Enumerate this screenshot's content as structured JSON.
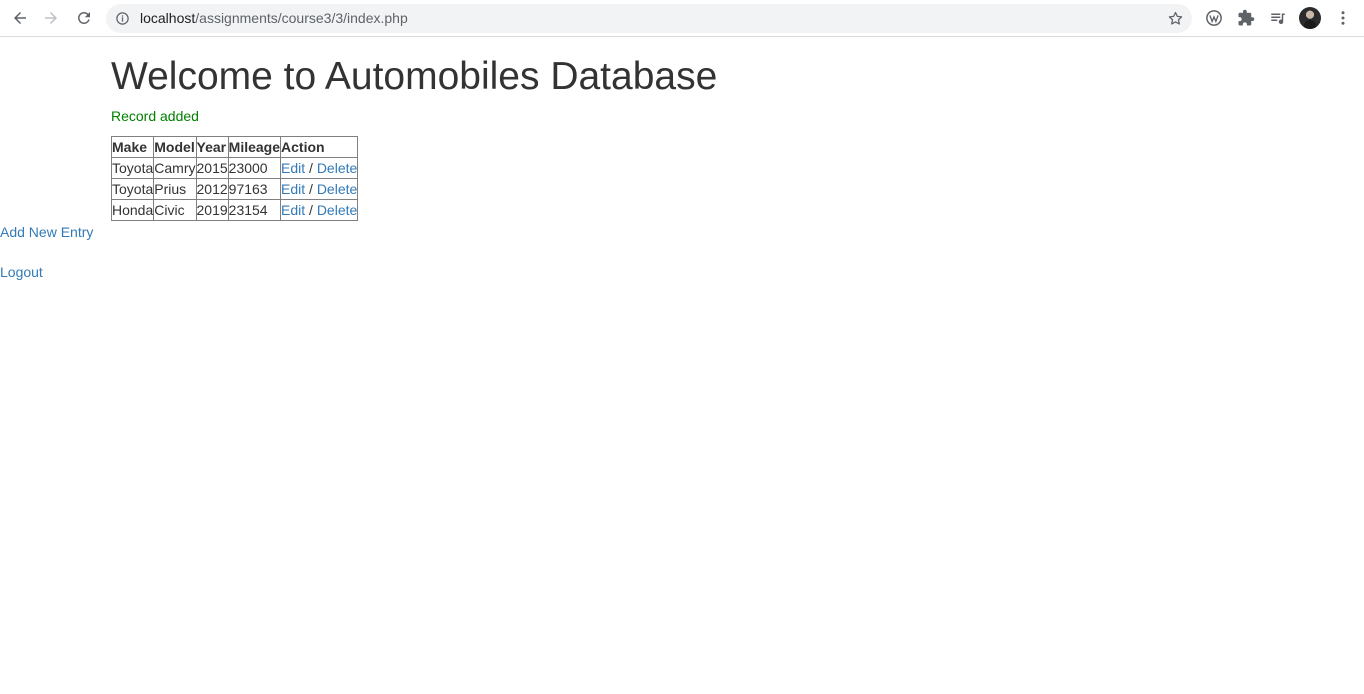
{
  "browser": {
    "url_host": "localhost",
    "url_path": "/assignments/course3/3/index.php"
  },
  "page": {
    "title": "Welcome to Automobiles Database",
    "flash": "Record added",
    "table": {
      "headers": [
        "Make",
        "Model",
        "Year",
        "Mileage",
        "Action"
      ],
      "rows": [
        {
          "make": "Toyota",
          "model": "Camry",
          "year": "2015",
          "mileage": "23000",
          "edit": "Edit",
          "sep": " / ",
          "delete": "Delete"
        },
        {
          "make": "Toyota",
          "model": "Prius",
          "year": "2012",
          "mileage": "97163",
          "edit": "Edit",
          "sep": " / ",
          "delete": "Delete"
        },
        {
          "make": "Honda",
          "model": "Civic",
          "year": "2019",
          "mileage": "23154",
          "edit": "Edit",
          "sep": " / ",
          "delete": "Delete"
        }
      ]
    },
    "add_new": "Add New Entry",
    "logout": "Logout"
  },
  "colors": {
    "link": "#337ab7",
    "flash": "#008000",
    "text": "#333333"
  }
}
